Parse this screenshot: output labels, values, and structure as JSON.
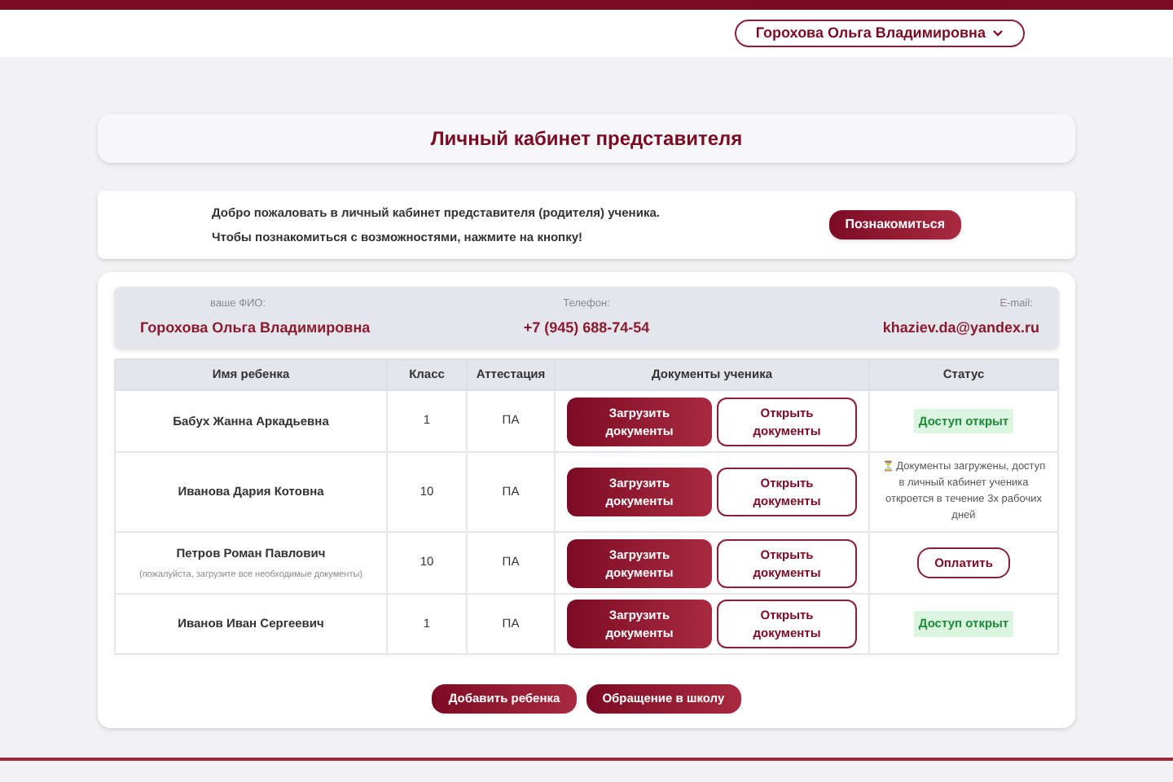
{
  "header": {
    "user_menu": "Горохова Ольга Владимировна"
  },
  "page_title": "Личный кабинет представителя",
  "welcome": {
    "lines": [
      "Добро пожаловать в личный кабинет представителя (родителя) ученика.",
      "Чтобы познакомиться с возможностями, нажмите на кнопку!"
    ],
    "button": "Познакомиться"
  },
  "profile": [
    {
      "label": "ваше ФИО:",
      "value": "Горохова Ольга Владимировна"
    },
    {
      "label": "Телефон:",
      "value": "+7 (945) 688-74-54"
    },
    {
      "label": "E-mail:",
      "value": "khaziev.da@yandex.ru"
    }
  ],
  "table": {
    "columns": [
      "Имя ребенка",
      "Класс",
      "Аттестация",
      "Документы ученика",
      "Статус"
    ],
    "rows": [
      {
        "name": "Бабух Жанна Аркадьевна",
        "grade": "1",
        "attestation": "ПА",
        "upload": "Загрузить документы",
        "open": "Открыть документы",
        "status": {
          "kind": "badge",
          "text": "Доступ открыт"
        }
      },
      {
        "name": "Иванова Дария Котовна",
        "grade": "10",
        "attestation": "ПА",
        "upload": "Загрузить документы",
        "open": "Открыть документы",
        "status": {
          "kind": "note",
          "icon": "⏳",
          "text": "Документы загружены, доступ в личный кабинет ученика откроется в течение 3х рабочих дней"
        }
      },
      {
        "name": "Петров Роман Павлович",
        "note": "(пожалуйста, загрузите все необходимые документы)",
        "grade": "10",
        "attestation": "ПА",
        "upload": "Загрузить документы",
        "open": "Открыть документы",
        "status": {
          "kind": "button",
          "text": "Оплатить"
        }
      },
      {
        "name": "Иванов Иван Сергеевич",
        "grade": "1",
        "attestation": "ПА",
        "upload": "Загрузить документы",
        "open": "Открыть документы",
        "status": {
          "kind": "badge",
          "text": "Доступ открыт"
        }
      }
    ]
  },
  "actions": [
    "Добавить ребенка",
    "Обращение в школу"
  ]
}
